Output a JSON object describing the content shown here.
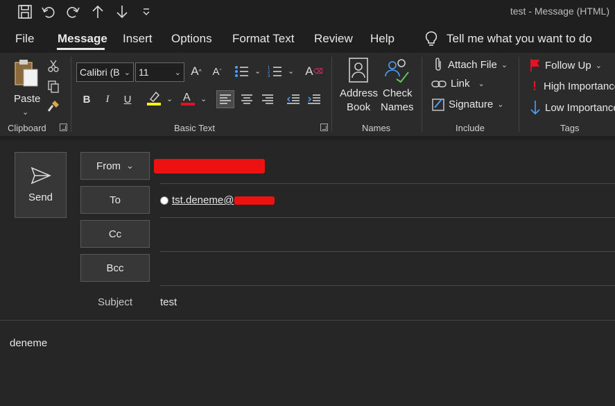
{
  "window": {
    "title": "test  -  Message (HTML)"
  },
  "menu": {
    "tabs": [
      "File",
      "Message",
      "Insert",
      "Options",
      "Format Text",
      "Review",
      "Help"
    ],
    "active_tab": "Message",
    "tell_me": "Tell me what you want to do"
  },
  "ribbon": {
    "clipboard": {
      "paste_label": "Paste",
      "group_label": "Clipboard"
    },
    "basic_text": {
      "font_name": "Calibri (B",
      "font_size": "11",
      "group_label": "Basic Text",
      "highlight_color": "#ffff00",
      "font_color": "#e81123"
    },
    "names": {
      "address_book_line1": "Address",
      "address_book_line2": "Book",
      "check_names_line1": "Check",
      "check_names_line2": "Names",
      "group_label": "Names"
    },
    "include": {
      "attach_file": "Attach File",
      "link": "Link",
      "signature": "Signature",
      "group_label": "Include"
    },
    "tags": {
      "follow_up": "Follow Up",
      "high_importance": "High Importance",
      "low_importance": "Low Importance",
      "group_label": "Tags"
    }
  },
  "compose": {
    "send_label": "Send",
    "from_label": "From",
    "to_label": "To",
    "cc_label": "Cc",
    "bcc_label": "Bcc",
    "to_recipient": "tst.deneme@",
    "subject_label": "Subject",
    "subject_value": "test",
    "body_text": "deneme"
  }
}
